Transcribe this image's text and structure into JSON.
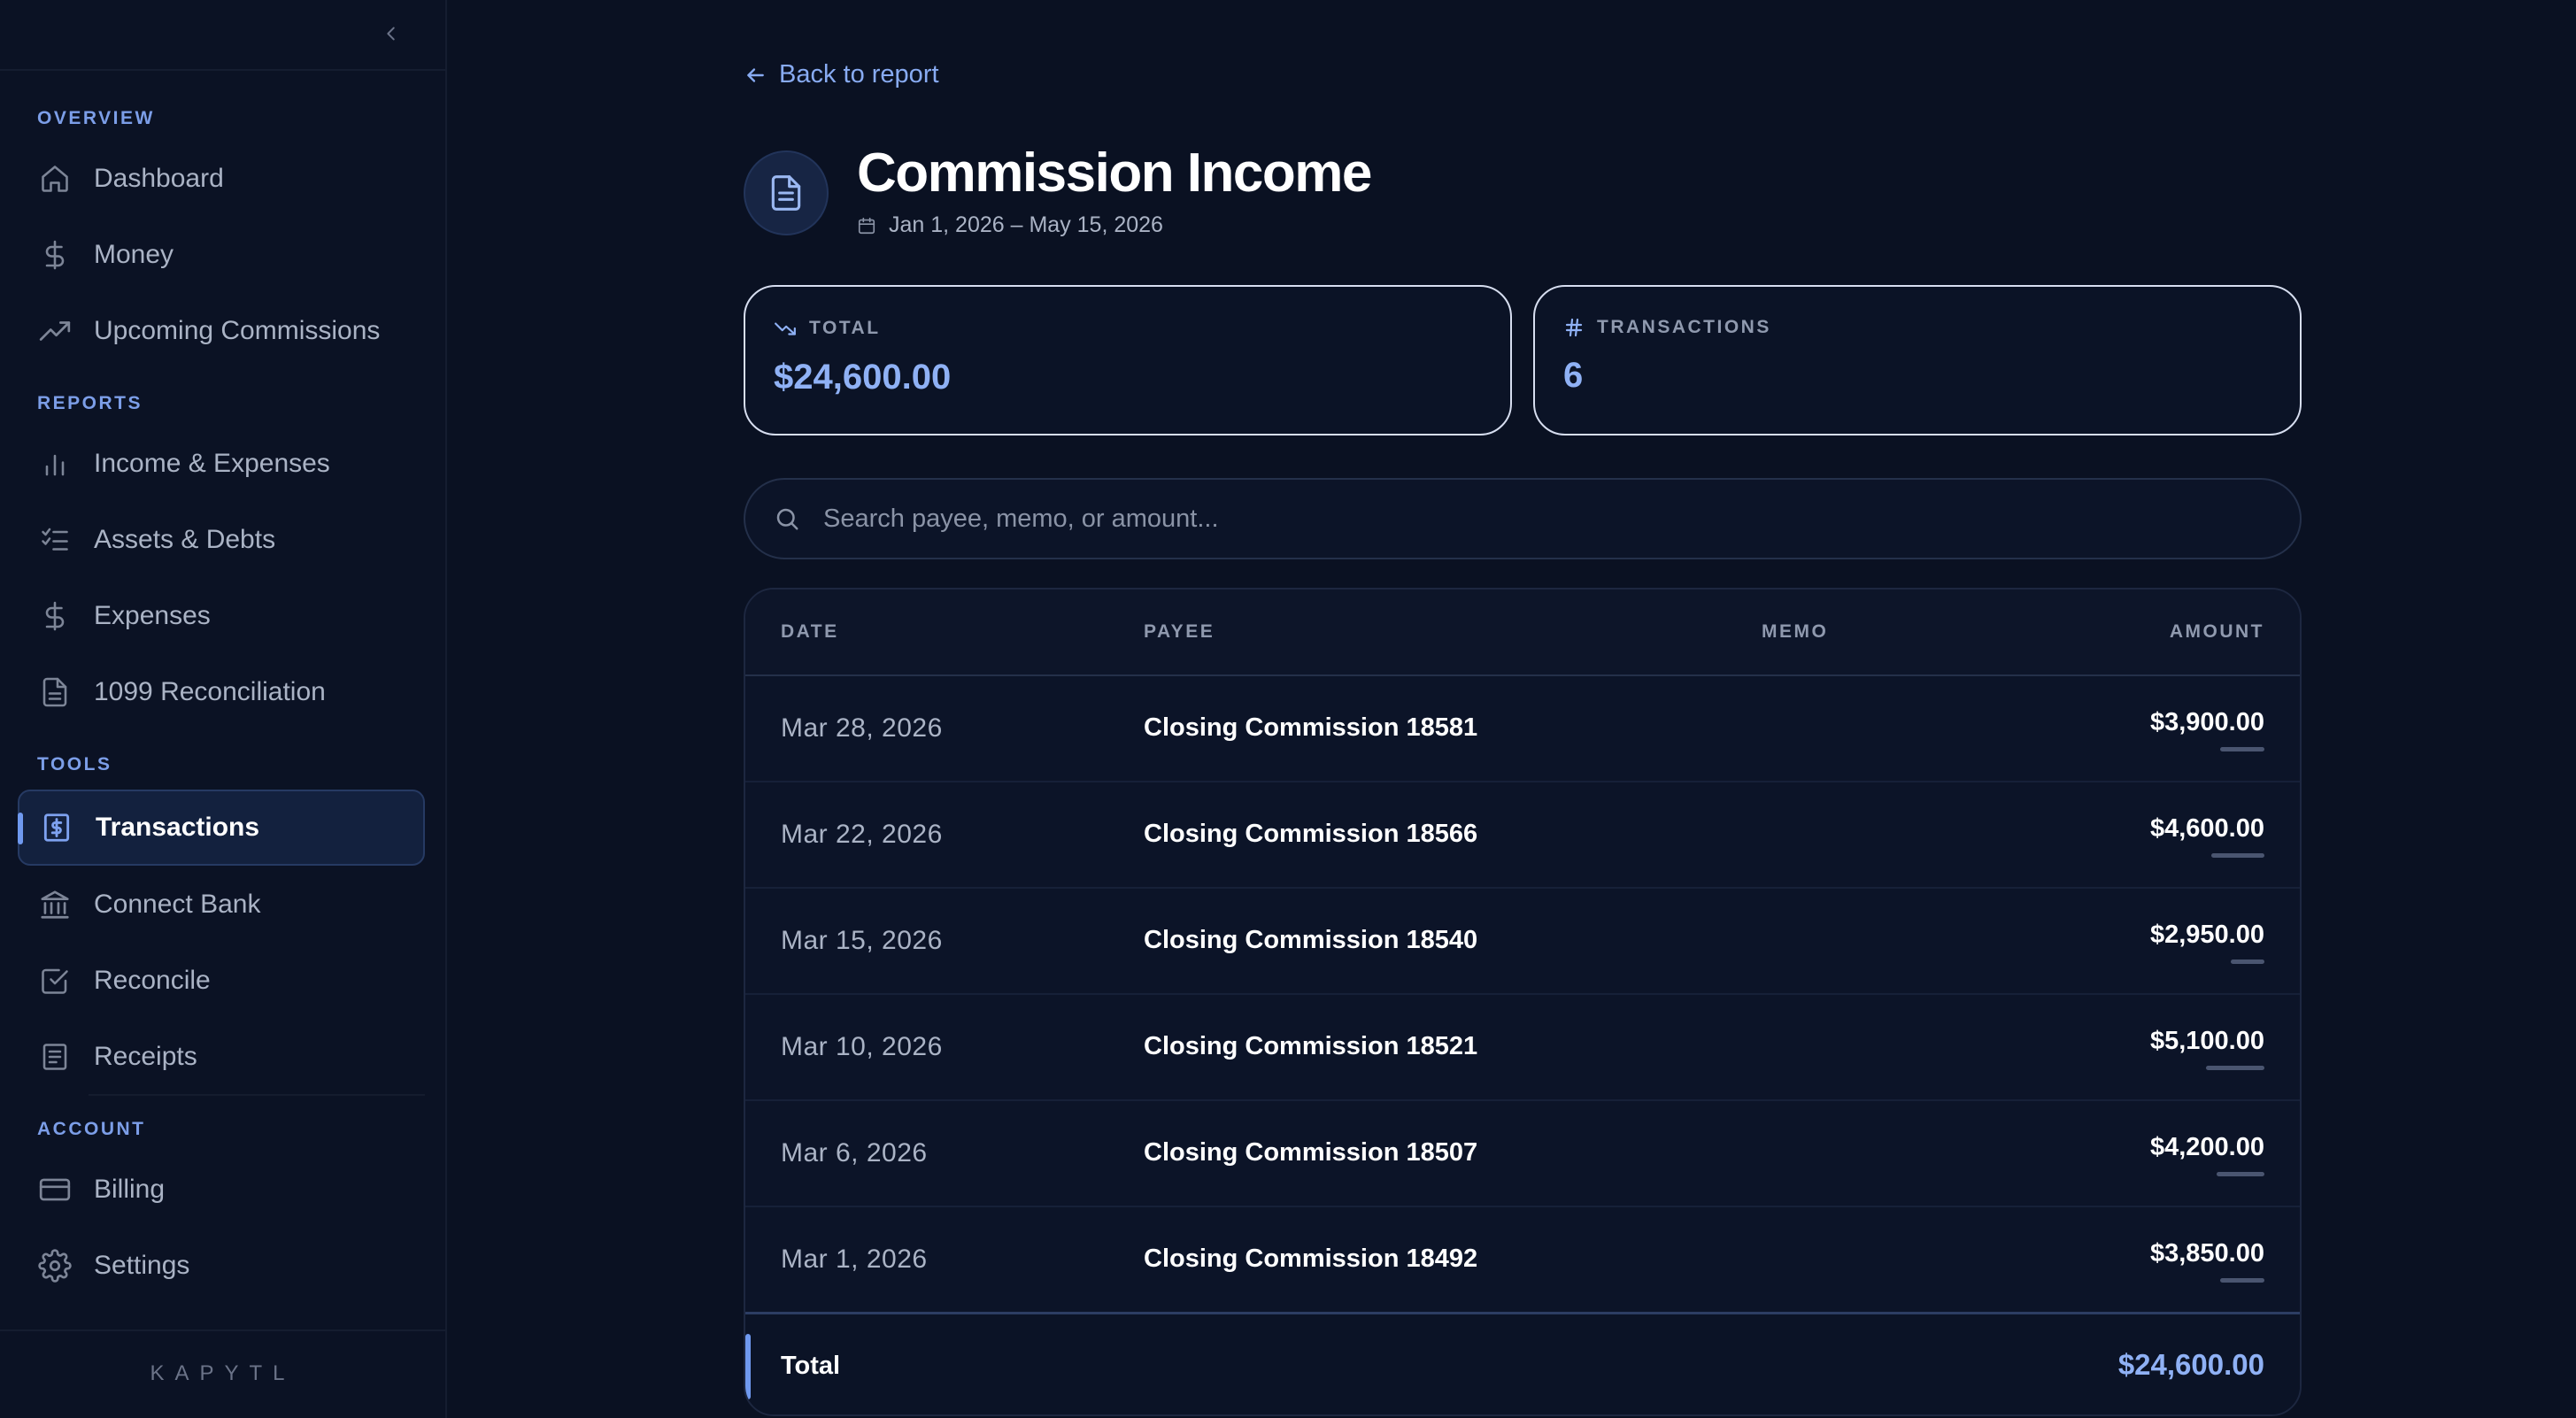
{
  "sidebar": {
    "sections": {
      "overview": "OVERVIEW",
      "reports": "REPORTS",
      "tools": "TOOLS",
      "account": "ACCOUNT"
    },
    "items": {
      "dashboard": "Dashboard",
      "money": "Money",
      "upcoming": "Upcoming Commissions",
      "income_expenses": "Income & Expenses",
      "assets_debts": "Assets & Debts",
      "expenses": "Expenses",
      "reconciliation_1099": "1099 Reconciliation",
      "transactions": "Transactions",
      "connect_bank": "Connect Bank",
      "reconcile": "Reconcile",
      "receipts": "Receipts",
      "billing": "Billing",
      "settings": "Settings"
    },
    "active_item": "Transactions",
    "brand": "KAPYTL"
  },
  "header": {
    "back_label": "Back to report",
    "title": "Commission Income",
    "date_range": "Jan 1, 2026 – May 15, 2026"
  },
  "stats": {
    "total_label": "TOTAL",
    "total_value": "$24,600.00",
    "transactions_label": "TRANSACTIONS",
    "transactions_value": "6"
  },
  "search": {
    "placeholder": "Search payee, memo, or amount..."
  },
  "table": {
    "headers": {
      "date": "DATE",
      "payee": "PAYEE",
      "memo": "MEMO",
      "amount": "AMOUNT"
    },
    "rows": [
      {
        "date": "Mar 28, 2026",
        "payee": "Closing Commission 18581",
        "memo": "",
        "amount": "$3,900.00",
        "value": 3900
      },
      {
        "date": "Mar 22, 2026",
        "payee": "Closing Commission 18566",
        "memo": "",
        "amount": "$4,600.00",
        "value": 4600
      },
      {
        "date": "Mar 15, 2026",
        "payee": "Closing Commission 18540",
        "memo": "",
        "amount": "$2,950.00",
        "value": 2950
      },
      {
        "date": "Mar 10, 2026",
        "payee": "Closing Commission 18521",
        "memo": "",
        "amount": "$5,100.00",
        "value": 5100
      },
      {
        "date": "Mar 6, 2026",
        "payee": "Closing Commission 18507",
        "memo": "",
        "amount": "$4,200.00",
        "value": 4200
      },
      {
        "date": "Mar 1, 2026",
        "payee": "Closing Commission 18492",
        "memo": "",
        "amount": "$3,850.00",
        "value": 3850
      }
    ],
    "total_label": "Total",
    "total_value": "$24,600.00"
  },
  "colors": {
    "accent": "#6f99ef",
    "accent_text": "#8fb1f5",
    "background": "#0a1122"
  }
}
